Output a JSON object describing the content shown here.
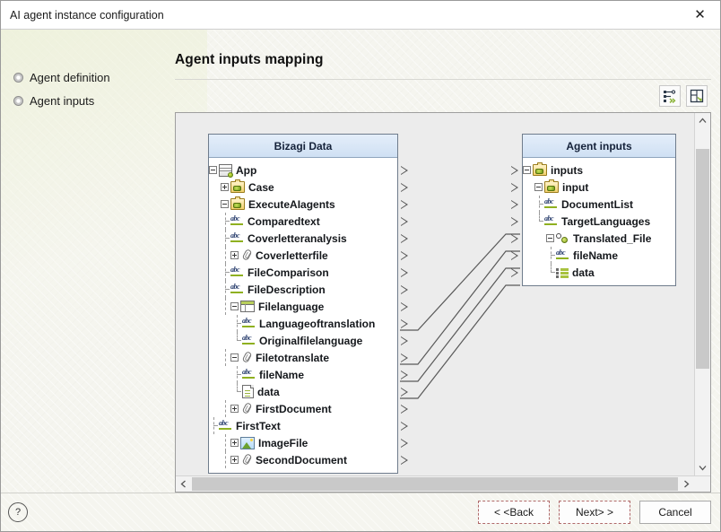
{
  "window": {
    "title": "AI agent instance configuration",
    "close_label": "✕"
  },
  "sidebar": {
    "items": [
      {
        "label": "Agent definition"
      },
      {
        "label": "Agent inputs"
      }
    ]
  },
  "main": {
    "page_title": "Agent inputs mapping",
    "toolbar": [
      {
        "name": "auto-map-button",
        "tooltip": "Auto map"
      },
      {
        "name": "arrange-layout-button",
        "tooltip": "Arrange"
      }
    ]
  },
  "mapper": {
    "left_panel": {
      "header": "Bizagi Data",
      "rows": [
        {
          "label": "App",
          "indent": 0,
          "expander": "minus",
          "icon": "app-icon",
          "guide": "none",
          "port": true
        },
        {
          "label": "Case",
          "indent": 1,
          "expander": "plus",
          "icon": "case-icon",
          "guide": "none",
          "port": true
        },
        {
          "label": "ExecuteAIagents",
          "indent": 1,
          "expander": "minus",
          "icon": "case-icon",
          "guide": "none",
          "port": true
        },
        {
          "label": "Comparedtext",
          "indent": 2,
          "expander": "none",
          "icon": "abc-icon",
          "guide": "tee",
          "port": true
        },
        {
          "label": "Coverletteranalysis",
          "indent": 2,
          "expander": "none",
          "icon": "abc-icon",
          "guide": "tee",
          "port": true
        },
        {
          "label": "Coverletterfile",
          "indent": 2,
          "expander": "plus",
          "icon": "clip-icon",
          "guide": "vert",
          "port": true
        },
        {
          "label": "FileComparison",
          "indent": 2,
          "expander": "none",
          "icon": "abc-icon",
          "guide": "tee",
          "port": true
        },
        {
          "label": "FileDescription",
          "indent": 2,
          "expander": "none",
          "icon": "abc-icon",
          "guide": "tee",
          "port": true
        },
        {
          "label": "Filelanguage",
          "indent": 2,
          "expander": "minus",
          "icon": "table-icon",
          "guide": "vert",
          "port": true
        },
        {
          "label": "Languageoftranslation",
          "indent": 3,
          "expander": "none",
          "icon": "abc-icon",
          "guide": "tee",
          "port": true
        },
        {
          "label": "Originalfilelanguage",
          "indent": 3,
          "expander": "none",
          "icon": "abc-icon",
          "guide": "last",
          "port": true
        },
        {
          "label": "Filetotranslate",
          "indent": 2,
          "expander": "minus",
          "icon": "clip-icon",
          "guide": "vert",
          "port": true
        },
        {
          "label": "fileName",
          "indent": 3,
          "expander": "none",
          "icon": "abc-icon",
          "guide": "tee",
          "port": true
        },
        {
          "label": "data",
          "indent": 3,
          "expander": "none",
          "icon": "doc-icon",
          "guide": "last",
          "port": true
        },
        {
          "label": "FirstDocument",
          "indent": 2,
          "expander": "plus",
          "icon": "clip-icon",
          "guide": "vert",
          "port": true
        },
        {
          "label": "FirstText",
          "indent": 1,
          "expander": "none",
          "icon": "abc-icon",
          "guide": "tee",
          "port": true
        },
        {
          "label": "ImageFile",
          "indent": 2,
          "expander": "plus",
          "icon": "image-icon",
          "guide": "vert",
          "port": true
        },
        {
          "label": "SecondDocument",
          "indent": 2,
          "expander": "plus",
          "icon": "clip-icon",
          "guide": "vert",
          "port": true
        }
      ]
    },
    "right_panel": {
      "header": "Agent inputs",
      "rows": [
        {
          "label": "inputs",
          "indent": 0,
          "expander": "minus",
          "icon": "case-icon",
          "guide": "none",
          "port": true
        },
        {
          "label": "input",
          "indent": 1,
          "expander": "minus",
          "icon": "case-icon",
          "guide": "none",
          "port": true
        },
        {
          "label": "DocumentList",
          "indent": 2,
          "expander": "none",
          "icon": "abc-icon",
          "guide": "tee",
          "port": true
        },
        {
          "label": "TargetLanguages",
          "indent": 2,
          "expander": "none",
          "icon": "abc-icon",
          "guide": "last",
          "port": true
        },
        {
          "label": "Translated_File",
          "indent": 2,
          "expander": "minus",
          "icon": "type-icon",
          "guide": "none",
          "port": true
        },
        {
          "label": "fileName",
          "indent": 3,
          "expander": "none",
          "icon": "abc-icon",
          "guide": "tee",
          "port": true
        },
        {
          "label": "data",
          "indent": 3,
          "expander": "none",
          "icon": "list-icon",
          "guide": "last",
          "port": true
        }
      ]
    },
    "connections": [
      {
        "from": "Languageoftranslation",
        "to": "TargetLanguages",
        "from_row": 9,
        "to_row": 3
      },
      {
        "from": "Filetotranslate",
        "to": "Translated_File",
        "from_row": 11,
        "to_row": 4
      },
      {
        "from": "fileName",
        "to": "fileName",
        "from_row": 12,
        "to_row": 5
      },
      {
        "from": "data",
        "to": "data",
        "from_row": 13,
        "to_row": 6
      }
    ]
  },
  "scrollbars": {
    "vertical_up": "▲",
    "vertical_down": "▼",
    "horizontal_left": "◀",
    "horizontal_right": "▶"
  },
  "footer": {
    "help_label": "?",
    "buttons": [
      {
        "label": "< <Back",
        "name": "back-button",
        "style": "dashed"
      },
      {
        "label": "Next> >",
        "name": "next-button",
        "style": "dashed"
      },
      {
        "label": "Cancel",
        "name": "cancel-button",
        "style": "plain"
      }
    ]
  },
  "colors": {
    "panel_header_top": "#e4eefa",
    "panel_header_bottom": "#cfe0f3",
    "canvas": "#ececec",
    "accent_green": "#8fb020"
  }
}
